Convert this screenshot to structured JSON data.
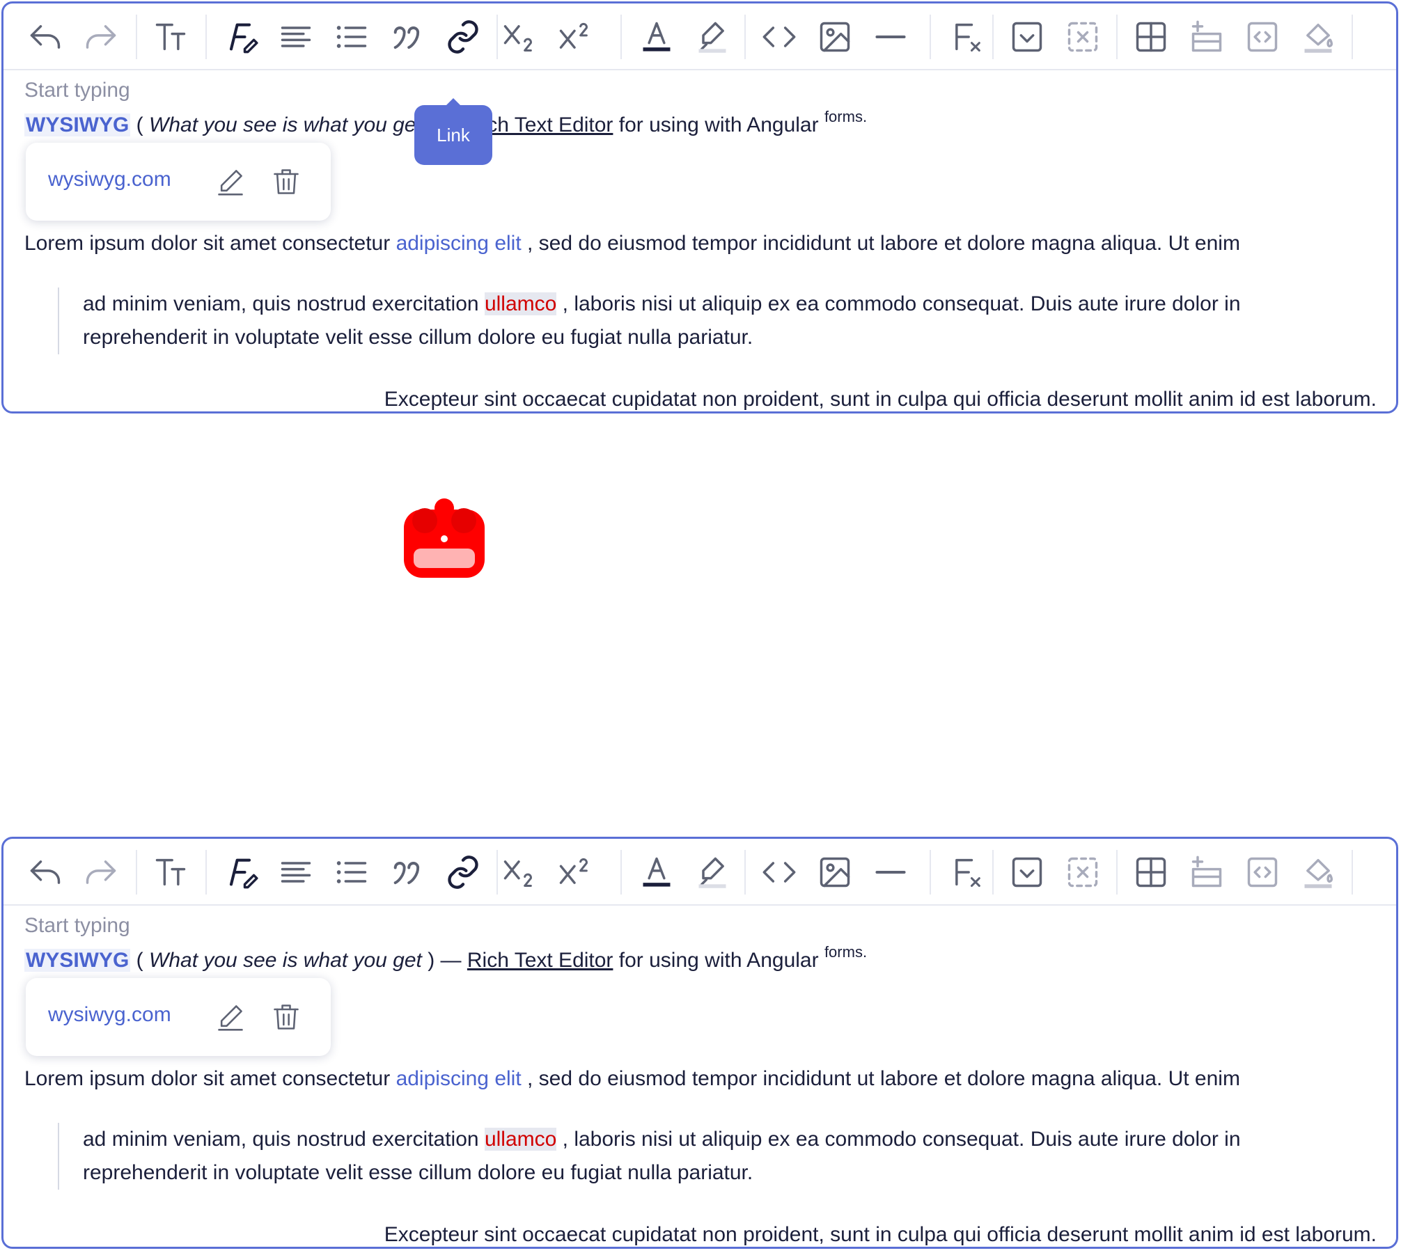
{
  "toolbar": {
    "buttons": [
      {
        "name": "undo-icon"
      },
      {
        "name": "redo-icon"
      },
      {
        "name": "font-size-icon"
      },
      {
        "name": "font-style-icon"
      },
      {
        "name": "align-icon"
      },
      {
        "name": "bullet-list-icon"
      },
      {
        "name": "blockquote-icon"
      },
      {
        "name": "link-icon"
      },
      {
        "name": "subscript-icon"
      },
      {
        "name": "superscript-icon"
      },
      {
        "name": "text-color-icon"
      },
      {
        "name": "highlight-icon"
      },
      {
        "name": "code-icon"
      },
      {
        "name": "image-icon"
      },
      {
        "name": "horizontal-rule-icon"
      },
      {
        "name": "clear-format-icon"
      },
      {
        "name": "insert-field-icon"
      },
      {
        "name": "remove-field-icon"
      },
      {
        "name": "table-icon"
      },
      {
        "name": "insert-row-icon"
      },
      {
        "name": "embed-icon"
      },
      {
        "name": "fill-color-icon"
      }
    ]
  },
  "tooltip": {
    "label": "Link"
  },
  "doc": {
    "placeholder": "Start typing",
    "line1": {
      "badge": "WYSIWYG",
      "open_paren": " ( ",
      "italic": "What you see is what you get",
      "close_paren": " ) — ",
      "link_text": "Rich Text Editor",
      "rest": " for using with Angular ",
      "sup": "forms."
    },
    "link_popup": {
      "url": "wysiwyg.com"
    },
    "para": {
      "before": "Lorem ipsum dolor sit amet consectetur ",
      "link": "adipiscing elit",
      "after": " , sed do eiusmod tempor incididunt ut labore et dolore magna aliqua. Ut enim"
    },
    "quote": {
      "line1_before": "ad minim veniam, quis nostrud exercitation ",
      "highlight": "ullamco",
      "line1_after": " , laboris nisi ut aliquip ex ea commodo consequat. Duis aute irure dolor in",
      "line2": "reprehenderit in voluptate velit esse cillum dolore eu fugiat nulla pariatur."
    },
    "right_para": "Excepteur sint occaecat cupidatat non proident, sunt in culpa qui officia deserunt mollit anim id est laborum."
  },
  "colors": {
    "accent": "#5a6fd6",
    "link": "#4a63cf",
    "highlight_text": "#d10000",
    "cursor_marker": "#ff0000"
  }
}
